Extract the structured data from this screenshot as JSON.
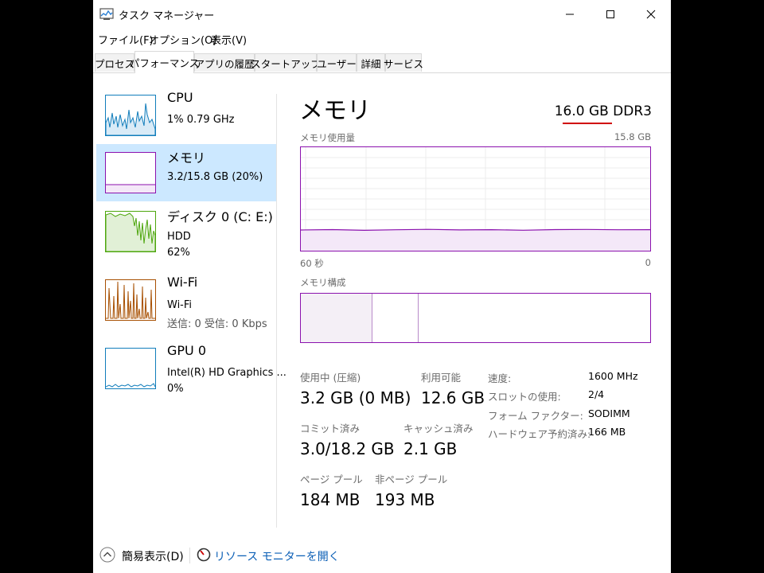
{
  "window": {
    "title": "タスク マネージャー",
    "controls": {
      "minimize": "—",
      "maximize": "☐",
      "close": "✕"
    }
  },
  "menu": [
    "ファイル(F)",
    "オプション(O)",
    "表示(V)"
  ],
  "tabs": [
    {
      "label": "プロセス",
      "active": false
    },
    {
      "label": "パフォーマンス",
      "active": true
    },
    {
      "label": "アプリの履歴",
      "active": false
    },
    {
      "label": "スタートアップ",
      "active": false
    },
    {
      "label": "ユーザー",
      "active": false
    },
    {
      "label": "詳細",
      "active": false
    },
    {
      "label": "サービス",
      "active": false
    }
  ],
  "sidebar": [
    {
      "title": "CPU",
      "line1": "1% 0.79 GHz",
      "line2": "",
      "color": "#117dbb",
      "selected": false
    },
    {
      "title": "メモリ",
      "line1": "3.2/15.8 GB (20%)",
      "line2": "",
      "color": "#8b12ae",
      "selected": true
    },
    {
      "title": "ディスク 0 (C: E:)",
      "line1": "HDD",
      "line2": "62%",
      "color": "#4da60c",
      "selected": false
    },
    {
      "title": "Wi-Fi",
      "line1": "Wi-Fi",
      "line2": "送信: 0 受信: 0 Kbps",
      "color": "#a74f01",
      "selected": false
    },
    {
      "title": "GPU 0",
      "line1": "Intel(R) HD Graphics ...",
      "line2": "0%",
      "color": "#117dbb",
      "selected": false
    }
  ],
  "main": {
    "title": "メモリ",
    "total": "16.0 GB DDR3",
    "usage_label": "メモリ使用量",
    "usage_max": "15.8 GB",
    "time_left": "60 秒",
    "time_right": "0",
    "usage_fraction": 0.2,
    "composition_label": "メモリ構成",
    "stats": {
      "in_use_label": "使用中 (圧縮)",
      "in_use_value": "3.2 GB (0 MB)",
      "available_label": "利用可能",
      "available_value": "12.6 GB",
      "committed_label": "コミット済み",
      "committed_value": "3.0/18.2 GB",
      "cached_label": "キャッシュ済み",
      "cached_value": "2.1 GB",
      "paged_label": "ページ プール",
      "paged_value": "184 MB",
      "nonpaged_label": "非ページ プール",
      "nonpaged_value": "193 MB"
    },
    "details": [
      {
        "key": "速度:",
        "value": "1600 MHz"
      },
      {
        "key": "スロットの使用:",
        "value": "2/4"
      },
      {
        "key": "フォーム ファクター:",
        "value": "SODIMM"
      },
      {
        "key": "ハードウェア予約済み:",
        "value": "166 MB"
      }
    ]
  },
  "footer": {
    "fewer_details": "簡易表示(D)",
    "resource_monitor": "リソース モニターを開く"
  },
  "colors": {
    "memory": "#8b12ae",
    "cpu": "#117dbb",
    "disk": "#4da60c",
    "wifi": "#a74f01",
    "link": "#0b5fb6",
    "selected_bg": "#cce8ff"
  }
}
